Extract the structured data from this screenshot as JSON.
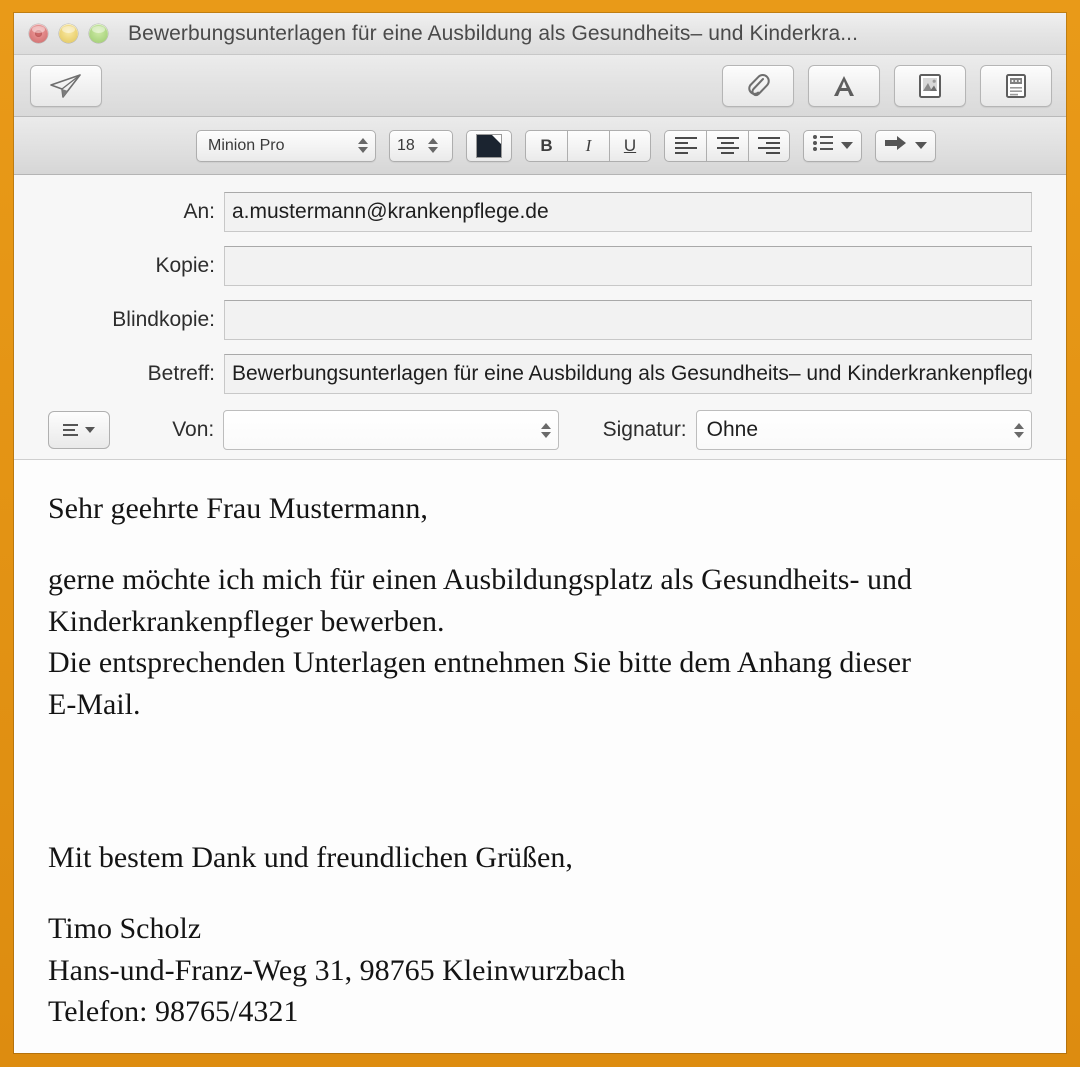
{
  "window": {
    "title": "Bewerbungsunterlagen für eine Ausbildung als Gesundheits– und Kinderkra...",
    "frame_color": "#e08a14",
    "controls": {
      "close": "close-button",
      "minimize": "minimize-button",
      "zoom": "zoom-button"
    }
  },
  "toolbar": {
    "send_label": "Senden",
    "attach_label": "Anhang",
    "fonts_label": "Schriften",
    "photo_browser_label": "Fotoübersicht",
    "stationery_label": "Briefpapier"
  },
  "format_bar": {
    "font_family": "Minion Pro",
    "font_size": "18",
    "text_color": "#1b2430",
    "bold": "B",
    "italic": "I",
    "underline": "U",
    "align_left_label": "Linksbündig",
    "align_center_label": "Zentriert",
    "align_right_label": "Rechtsbündig",
    "list_label": "Listen",
    "indent_label": "Einzug"
  },
  "headers": {
    "fields": [
      {
        "label": "An:",
        "value": "a.mustermann@krankenpflege.de"
      },
      {
        "label": "Kopie:",
        "value": ""
      },
      {
        "label": "Blindkopie:",
        "value": ""
      },
      {
        "label": "Betreff:",
        "value": "Bewerbungsunterlagen für eine Ausbildung als Gesundheits– und Kinderkrankenpfleger"
      }
    ],
    "from_label": "Von:",
    "from_value": "",
    "signature_label": "Signatur:",
    "signature_value": "Ohne",
    "menu_label": "Kopfzeilenfelder"
  },
  "body": {
    "salutation": "Sehr geehrte Frau Mustermann,",
    "paragraph1_line1": "gerne möchte ich mich für einen Ausbildungsplatz als Gesundheits- und",
    "paragraph1_line2": "Kinderkrankenpfleger bewerben.",
    "paragraph2_line1": "Die entsprechenden Unterlagen entnehmen Sie bitte dem Anhang dieser",
    "paragraph2_line2": "E-Mail.",
    "closing": "Mit bestem Dank und freundlichen Grüßen,",
    "sender_name": "Timo Scholz",
    "sender_address": "Hans-und-Franz-Weg 31, 98765 Kleinwurzbach",
    "sender_phone": "Telefon: 98765/4321"
  }
}
